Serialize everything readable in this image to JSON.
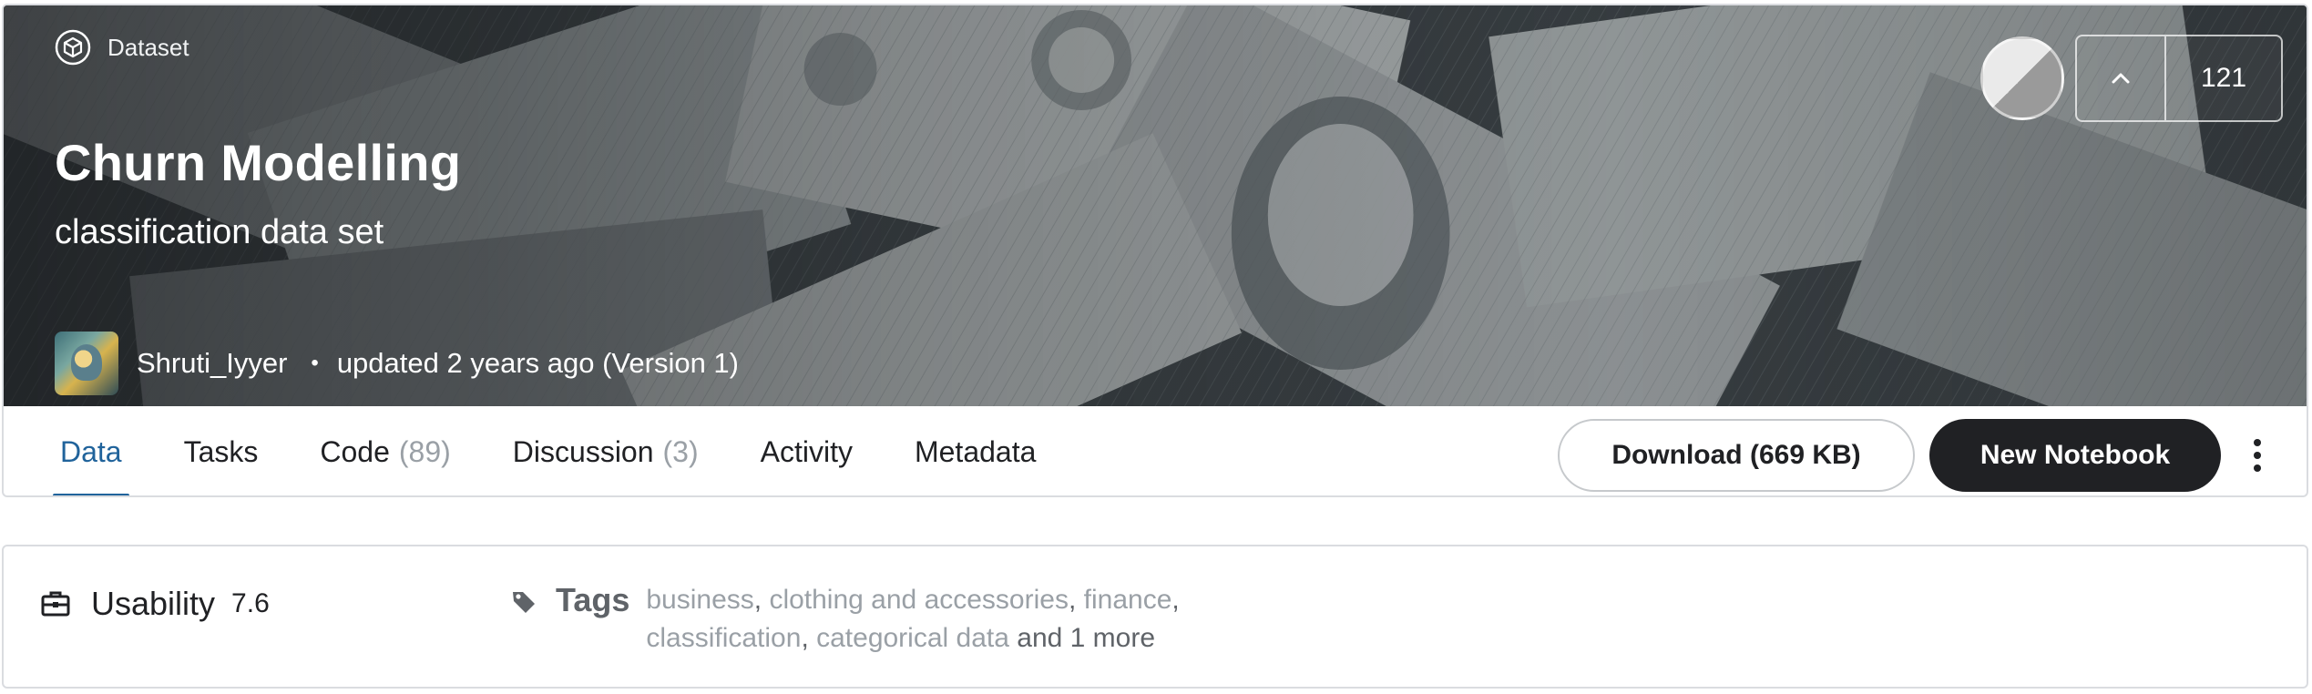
{
  "header": {
    "type_label": "Dataset",
    "title": "Churn Modelling",
    "subtitle": "classification data set",
    "owner": "Shruti_Iyyer",
    "separator": "•",
    "updated": "updated 2 years ago (Version 1)",
    "vote_count": "121"
  },
  "tabs": [
    {
      "label": "Data",
      "count": ""
    },
    {
      "label": "Tasks",
      "count": ""
    },
    {
      "label": "Code",
      "count": "(89)"
    },
    {
      "label": "Discussion",
      "count": "(3)"
    },
    {
      "label": "Activity",
      "count": ""
    },
    {
      "label": "Metadata",
      "count": ""
    }
  ],
  "actions": {
    "download_label": "Download (669 KB)",
    "new_notebook_label": "New Notebook"
  },
  "info": {
    "usability_label": "Usability",
    "usability_value": "7.6",
    "tags_label": "Tags",
    "tags": [
      "business",
      "clothing and accessories",
      "finance",
      "classification",
      "categorical data"
    ],
    "more_label": "and 1 more"
  },
  "colors": {
    "accent": "#20639b",
    "dark_button": "#202124",
    "muted_text": "#9aa0a6"
  },
  "icons": {
    "dataset": "cube-icon",
    "upvote": "chevron-up-icon",
    "more": "more-vertical-icon",
    "usability": "briefcase-icon",
    "tags": "tag-icon"
  }
}
